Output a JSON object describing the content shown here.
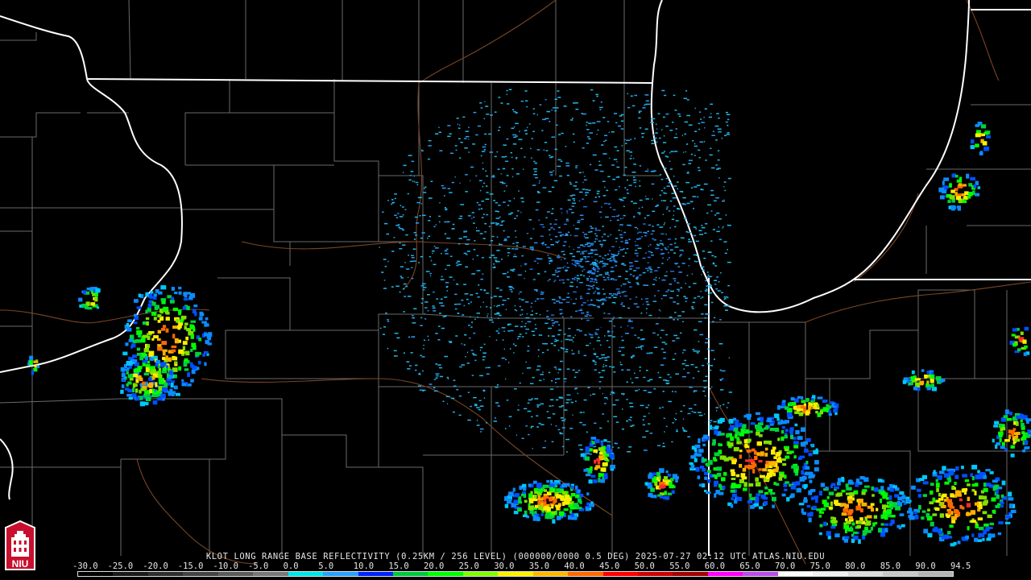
{
  "product_caption": "KLOT LONG RANGE BASE REFLECTIVITY (0.25KM / 256 LEVEL) (000000/0000 0.5 DEG) 2025-07-27 02:12 UTC  ATLAS.NIU.EDU",
  "logo": {
    "text": "NIU",
    "icon": "niu-tower-logo"
  },
  "scale_labels": [
    "-30.0",
    "-25.0",
    "-20.0",
    "-15.0",
    "-10.0",
    "-5.0",
    "0.0",
    "5.0",
    "10.0",
    "15.0",
    "20.0",
    "25.0",
    "30.0",
    "35.0",
    "40.0",
    "45.0",
    "50.0",
    "55.0",
    "60.0",
    "65.0",
    "70.0",
    "75.0",
    "80.0",
    "85.0",
    "90.0",
    "94.5"
  ],
  "scale_colors": [
    "#000000",
    "#1a1a1a",
    "#2e2e2e",
    "#444444",
    "#5c5c5c",
    "#787878",
    "#00e6e6",
    "#2aa0ff",
    "#0022ff",
    "#00c83c",
    "#00ff00",
    "#80ff00",
    "#fff000",
    "#ffb800",
    "#ff6a00",
    "#ff0000",
    "#cc0000",
    "#a00000",
    "#ff00ff",
    "#b84ee8",
    "#ffffff",
    "#f0f0f0",
    "#dcdcdc",
    "#c8c8c8",
    "#b4b4b4"
  ],
  "colors": {
    "state_border": "#ffffff",
    "county_line": "#6e6e6e",
    "river": "#7a4524",
    "background": "#000000"
  }
}
